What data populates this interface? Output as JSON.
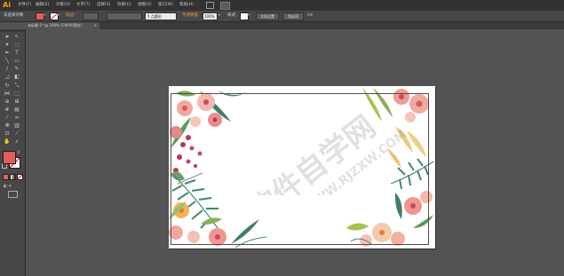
{
  "app": {
    "logo": "Ai"
  },
  "menu": [
    "文件(F)",
    "编辑(E)",
    "对象(O)",
    "文字(T)",
    "选择(S)",
    "效果(C)",
    "视图(V)",
    "窗口(W)",
    "帮助(H)"
  ],
  "control_bar": {
    "selection_status": "未选择对象",
    "stroke_label": "描边:",
    "stroke_value": "",
    "brush_value": "5 点圆形",
    "opacity_label": "不透明度:",
    "opacity_value": "100%",
    "style_label": "样式:",
    "document_setup_button": "文档设置",
    "preferences_button": "首选项"
  },
  "document_tab": {
    "title": "未标题-1* @ 300% (CMYK/预览)",
    "close": "×"
  },
  "colors": {
    "fill": "#e35d5b",
    "accent": "#ff9a00",
    "workspace": "#535353"
  },
  "tools": [
    "selection-tool",
    "direct-selection-tool",
    "magic-wand-tool",
    "lasso-tool",
    "pen-tool",
    "type-tool",
    "line-tool",
    "rectangle-tool",
    "paintbrush-tool",
    "pencil-tool",
    "blob-brush-tool",
    "eraser-tool",
    "rotate-tool",
    "scale-tool",
    "width-tool",
    "free-transform-tool",
    "shape-builder-tool",
    "perspective-grid-tool",
    "mesh-tool",
    "gradient-tool",
    "eyedropper-tool",
    "blend-tool",
    "symbol-sprayer-tool",
    "column-graph-tool",
    "artboard-tool",
    "slice-tool",
    "hand-tool",
    "zoom-tool"
  ],
  "watermark": {
    "text": "软件自学网",
    "url": "WWW.RJZXW.COM"
  }
}
